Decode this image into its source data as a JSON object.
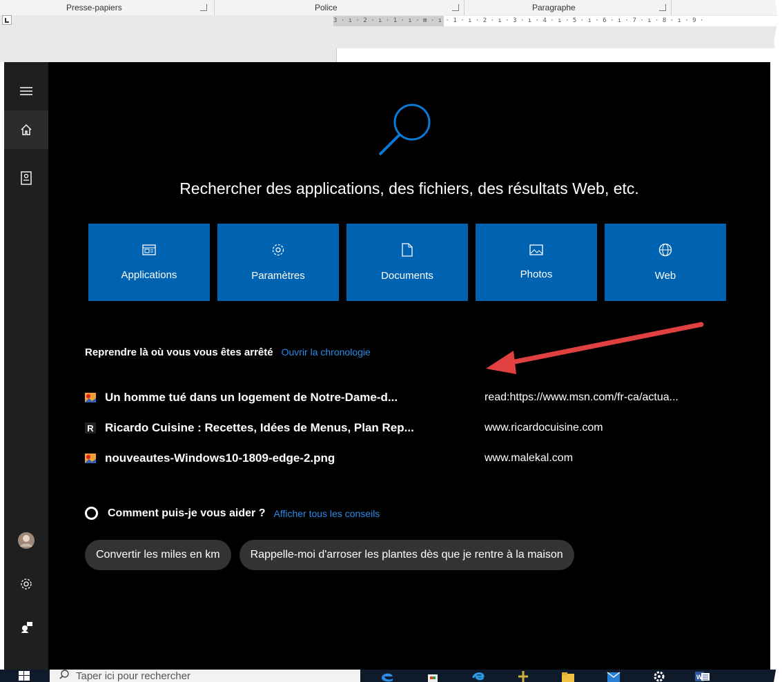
{
  "ribbon": {
    "groups": [
      "Presse-papiers",
      "Police",
      "Paragraphe"
    ],
    "ruler": "3 · ı · 2 · ı · 1 · ı · ⊠ · ı · 1 · ı · 2 · ı · 3 · ı · 4 · ı · 5 · ı · 6 · ı · 7 · ı · 8 · ı · 9 ·"
  },
  "search": {
    "headline": "Rechercher des applications, des fichiers, des résultats Web, etc.",
    "categories": [
      {
        "label": "Applications",
        "icon": "app-window-icon"
      },
      {
        "label": "Paramètres",
        "icon": "gear-icon"
      },
      {
        "label": "Documents",
        "icon": "document-icon"
      },
      {
        "label": "Photos",
        "icon": "photo-icon"
      },
      {
        "label": "Web",
        "icon": "globe-icon"
      }
    ],
    "resume": {
      "title": "Reprendre là où vous vous êtes arrêté",
      "link": "Ouvrir la chronologie",
      "items": [
        {
          "name": "Un homme tué dans un logement de Notre-Dame-d...",
          "url": "read:https://www.msn.com/fr-ca/actua...",
          "icon": "image-file-icon"
        },
        {
          "name": "Ricardo Cuisine : Recettes, Idées de Menus, Plan Rep...",
          "url": "www.ricardocuisine.com",
          "icon": "r-letter-icon",
          "icon_text": "R"
        },
        {
          "name": "nouveautes-Windows10-1809-edge-2.png",
          "url": "www.malekal.com",
          "icon": "image-file-icon"
        }
      ]
    },
    "help": {
      "title": "Comment puis-je vous aider ?",
      "link": "Afficher tous les conseils",
      "chips": [
        "Convertir les miles en km",
        "Rappelle-moi d'arroser les plantes dès que je rentre à la maison"
      ]
    }
  },
  "taskbar": {
    "search_placeholder": "Taper ici pour rechercher"
  },
  "colors": {
    "accent": "#0063b1",
    "link": "#2a8be8",
    "arrow": "#e04040"
  }
}
